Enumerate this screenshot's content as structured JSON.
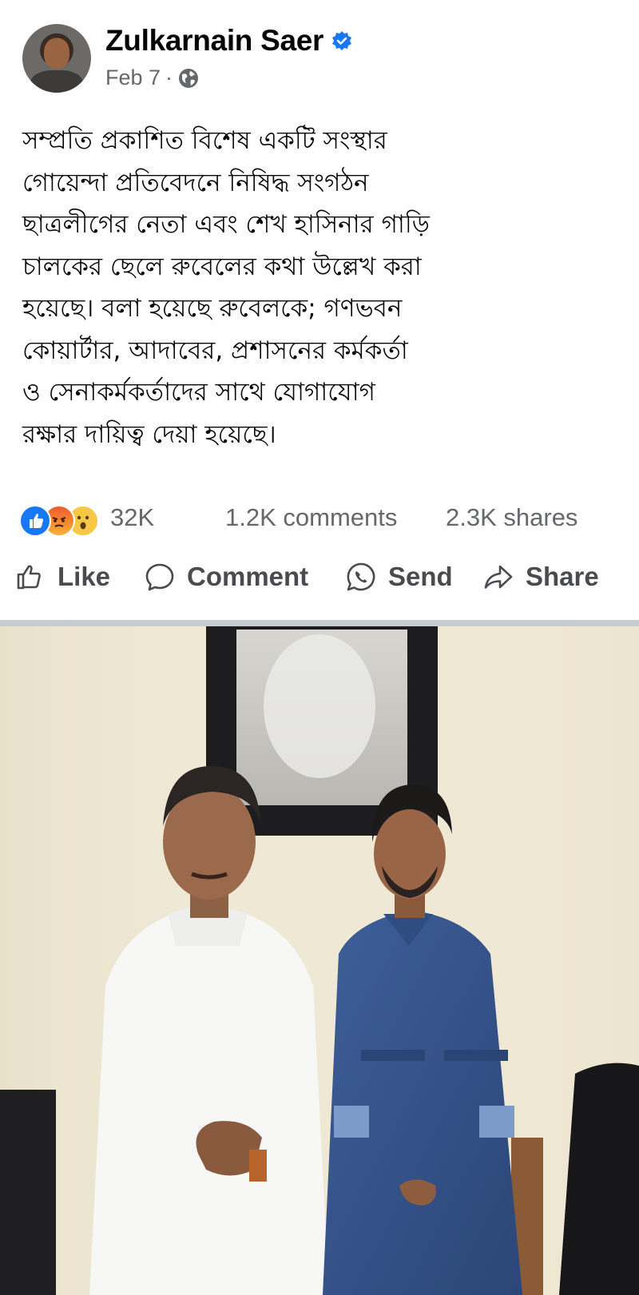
{
  "post": {
    "author": "Zulkarnain Saer",
    "date": "Feb 7",
    "date_separator": "·",
    "verified": true,
    "audience_icon": "globe-icon",
    "body": "সম্প্রতি প্রকাশিত বিশেষ একটি সংস্থার\nগোয়েন্দা প্রতিবেদনে নিষিদ্ধ সংগঠন\nছাত্রলীগের নেতা এবং শেখ হাসিনার গাড়ি\nচালকের ছেলে রুবেলের কথা উল্লেখ করা\nহয়েছে। বলা হয়েছে রুবেলকে; গণভবন\nকোয়ার্টার, আদাবের, প্রশাসনের কর্মকর্তা\nও সেনাকর্মকর্তাদের সাথে যোগাযোগ\nরক্ষার দায়িত্ব দেয়া হয়েছে।"
  },
  "stats": {
    "reactions_count": "32K",
    "reaction_icons": [
      "like-reaction-icon",
      "angry-reaction-icon",
      "wow-reaction-icon"
    ],
    "comments": "1.2K comments",
    "shares": "2.3K shares"
  },
  "actions": {
    "like": "Like",
    "comment": "Comment",
    "send": "Send",
    "share": "Share"
  },
  "colors": {
    "brand_blue": "#1877f2",
    "secondary_text": "#65676b",
    "divider": "#c8ccd2"
  },
  "photo": {
    "description_icon": "photo-two-men-standing"
  }
}
